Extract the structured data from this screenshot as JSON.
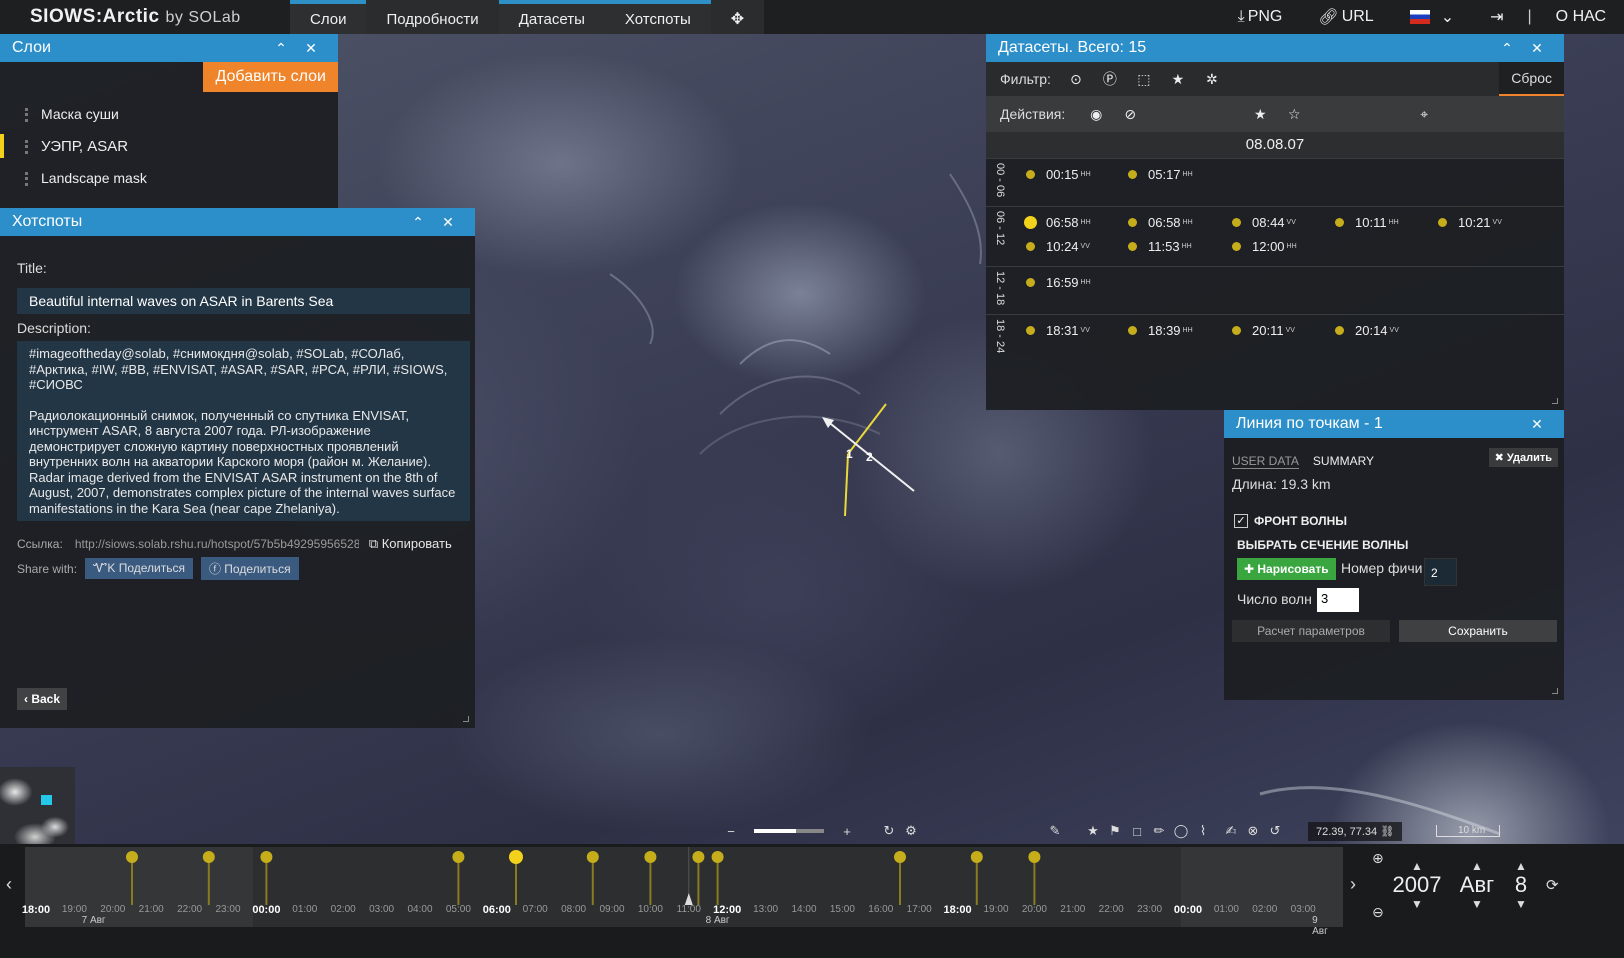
{
  "app": {
    "brand": "SIOWS:Arctic",
    "brand_by": "by SOLab"
  },
  "nav": {
    "tabs": [
      {
        "label": "Слои",
        "active": true
      },
      {
        "label": "Подробности",
        "active": false
      },
      {
        "label": "Датасеты",
        "active": true
      },
      {
        "label": "Хотспоты",
        "active": true
      }
    ],
    "compress_icon": "compress-icon",
    "png_label": "PNG",
    "url_label": "URL",
    "language": "RU",
    "about_label": "О НАС",
    "separator": "|"
  },
  "layers": {
    "title": "Слои",
    "add_label": "Добавить слои",
    "items": [
      {
        "label": "Маска суши",
        "active": false
      },
      {
        "label": "УЭПР, ASAR",
        "active": true
      },
      {
        "label": "Landscape mask",
        "active": false
      }
    ]
  },
  "hotspots": {
    "title": "Хотспоты",
    "title_label": "Title:",
    "title_value": "Beautiful internal waves on ASAR in Barents Sea",
    "description_label": "Description:",
    "description_p1": "#imageoftheday@solab, #снимокдня@solab, #SOLab, #СОЛаб, #Арктика, #IW, #BB, #ENVISAT, #ASAR, #SAR, #PCA, #РЛИ, #SIOWS, #СИОВС",
    "description_p2": "Радиолокационный снимок, полученный со спутника ENVISAT, инструмент ASAR, 8 августа 2007 года. РЛ-изображение демонстрирует сложную картину поверхностных проявлений внутренних волн на акватории Карского моря (район м. Желание). Radar image derived from the ENVISAT ASAR instrument on the 8th of August, 2007, demonstrates complex picture of the internal waves surface manifestations in the Kara Sea (near cape Zhelaniya).",
    "link_label": "Ссылка:",
    "link_value": "http://siows.solab.rshu.ru/hotspot/57b5b492959565280",
    "copy_label": "Копировать",
    "share_label": "Share with:",
    "share_vk": "Поделиться",
    "share_fb": "Поделиться",
    "back_label": "Back"
  },
  "datasets": {
    "title": "Датасеты. Всего: 15",
    "filter_label": "Фильтр:",
    "reset_label": "Сброс",
    "actions_label": "Действия:",
    "date": "08.08.07",
    "slots": [
      {
        "label": "00 - 06",
        "items": [
          {
            "time": "00:15",
            "sup": "HH"
          },
          {
            "time": "05:17",
            "sup": "HH"
          }
        ]
      },
      {
        "label": "06 - 12",
        "items": [
          {
            "time": "06:58",
            "sup": "HH",
            "selected": true
          },
          {
            "time": "06:58",
            "sup": "HH"
          },
          {
            "time": "08:44",
            "sup": "VV"
          },
          {
            "time": "10:11",
            "sup": "HH"
          },
          {
            "time": "10:21",
            "sup": "VV"
          },
          {
            "time": "10:24",
            "sup": "VV"
          },
          {
            "time": "11:53",
            "sup": "HH"
          },
          {
            "time": "12:00",
            "sup": "HH"
          }
        ]
      },
      {
        "label": "12 - 18",
        "items": [
          {
            "time": "16:59",
            "sup": "HH"
          }
        ]
      },
      {
        "label": "18 - 24",
        "items": [
          {
            "time": "18:31",
            "sup": "VV"
          },
          {
            "time": "18:39",
            "sup": "HH"
          },
          {
            "time": "20:11",
            "sup": "VV"
          },
          {
            "time": "20:14",
            "sup": "VV"
          }
        ]
      }
    ]
  },
  "linepanel": {
    "title": "Линия по точкам - 1",
    "tab_user": "USER DATA",
    "tab_summary": "SUMMARY",
    "delete_label": "Удалить",
    "length_label": "Длина:",
    "length_value": "19.3 km",
    "wavefront_label": "ФРОНТ ВОЛНЫ",
    "section_label": "ВЫБРАТЬ СЕЧЕНИЕ ВОЛНЫ",
    "draw_label": "Нарисовать",
    "feature_label": "Номер фичи",
    "feature_value": "2",
    "waves_label": "Число волн",
    "waves_value": "3",
    "calc_label": "Расчет параметров",
    "save_label": "Сохранить"
  },
  "map": {
    "point1": "1",
    "point2": "2",
    "coords": "72.39, 77.34",
    "scale": "10 km",
    "zoom_minus": "−",
    "zoom_plus": "+",
    "zoom_level": 0.6
  },
  "timeline": {
    "ticks": [
      "18:00",
      "19:00",
      "20:00",
      "21:00",
      "22:00",
      "23:00",
      "00:00",
      "01:00",
      "02:00",
      "03:00",
      "04:00",
      "05:00",
      "06:00",
      "07:00",
      "08:00",
      "09:00",
      "10:00",
      "11:00",
      "12:00",
      "13:00",
      "14:00",
      "15:00",
      "16:00",
      "17:00",
      "18:00",
      "19:00",
      "20:00",
      "21:00",
      "22:00",
      "23:00",
      "00:00",
      "01:00",
      "02:00",
      "03:00"
    ],
    "major": [
      "00:00",
      "06:00",
      "12:00",
      "18:00"
    ],
    "days": [
      "7 Авг",
      "8 Авг",
      "9 Авг"
    ],
    "datasets_hours": [
      -3.5,
      -1.5,
      0.0,
      5.0,
      6.5,
      8.5,
      10.0,
      11.25,
      11.75,
      16.5,
      18.5,
      20.0
    ],
    "selected_hour": 6.5,
    "current_hour": 11.0
  },
  "datepicker": {
    "year": "2007",
    "month": "Авг",
    "day": "8"
  },
  "colors": {
    "accent": "#2c8fc9",
    "orange": "#f0842a",
    "dataset_dot": "#c6ad1b",
    "selected_dot": "#f2d21a"
  }
}
